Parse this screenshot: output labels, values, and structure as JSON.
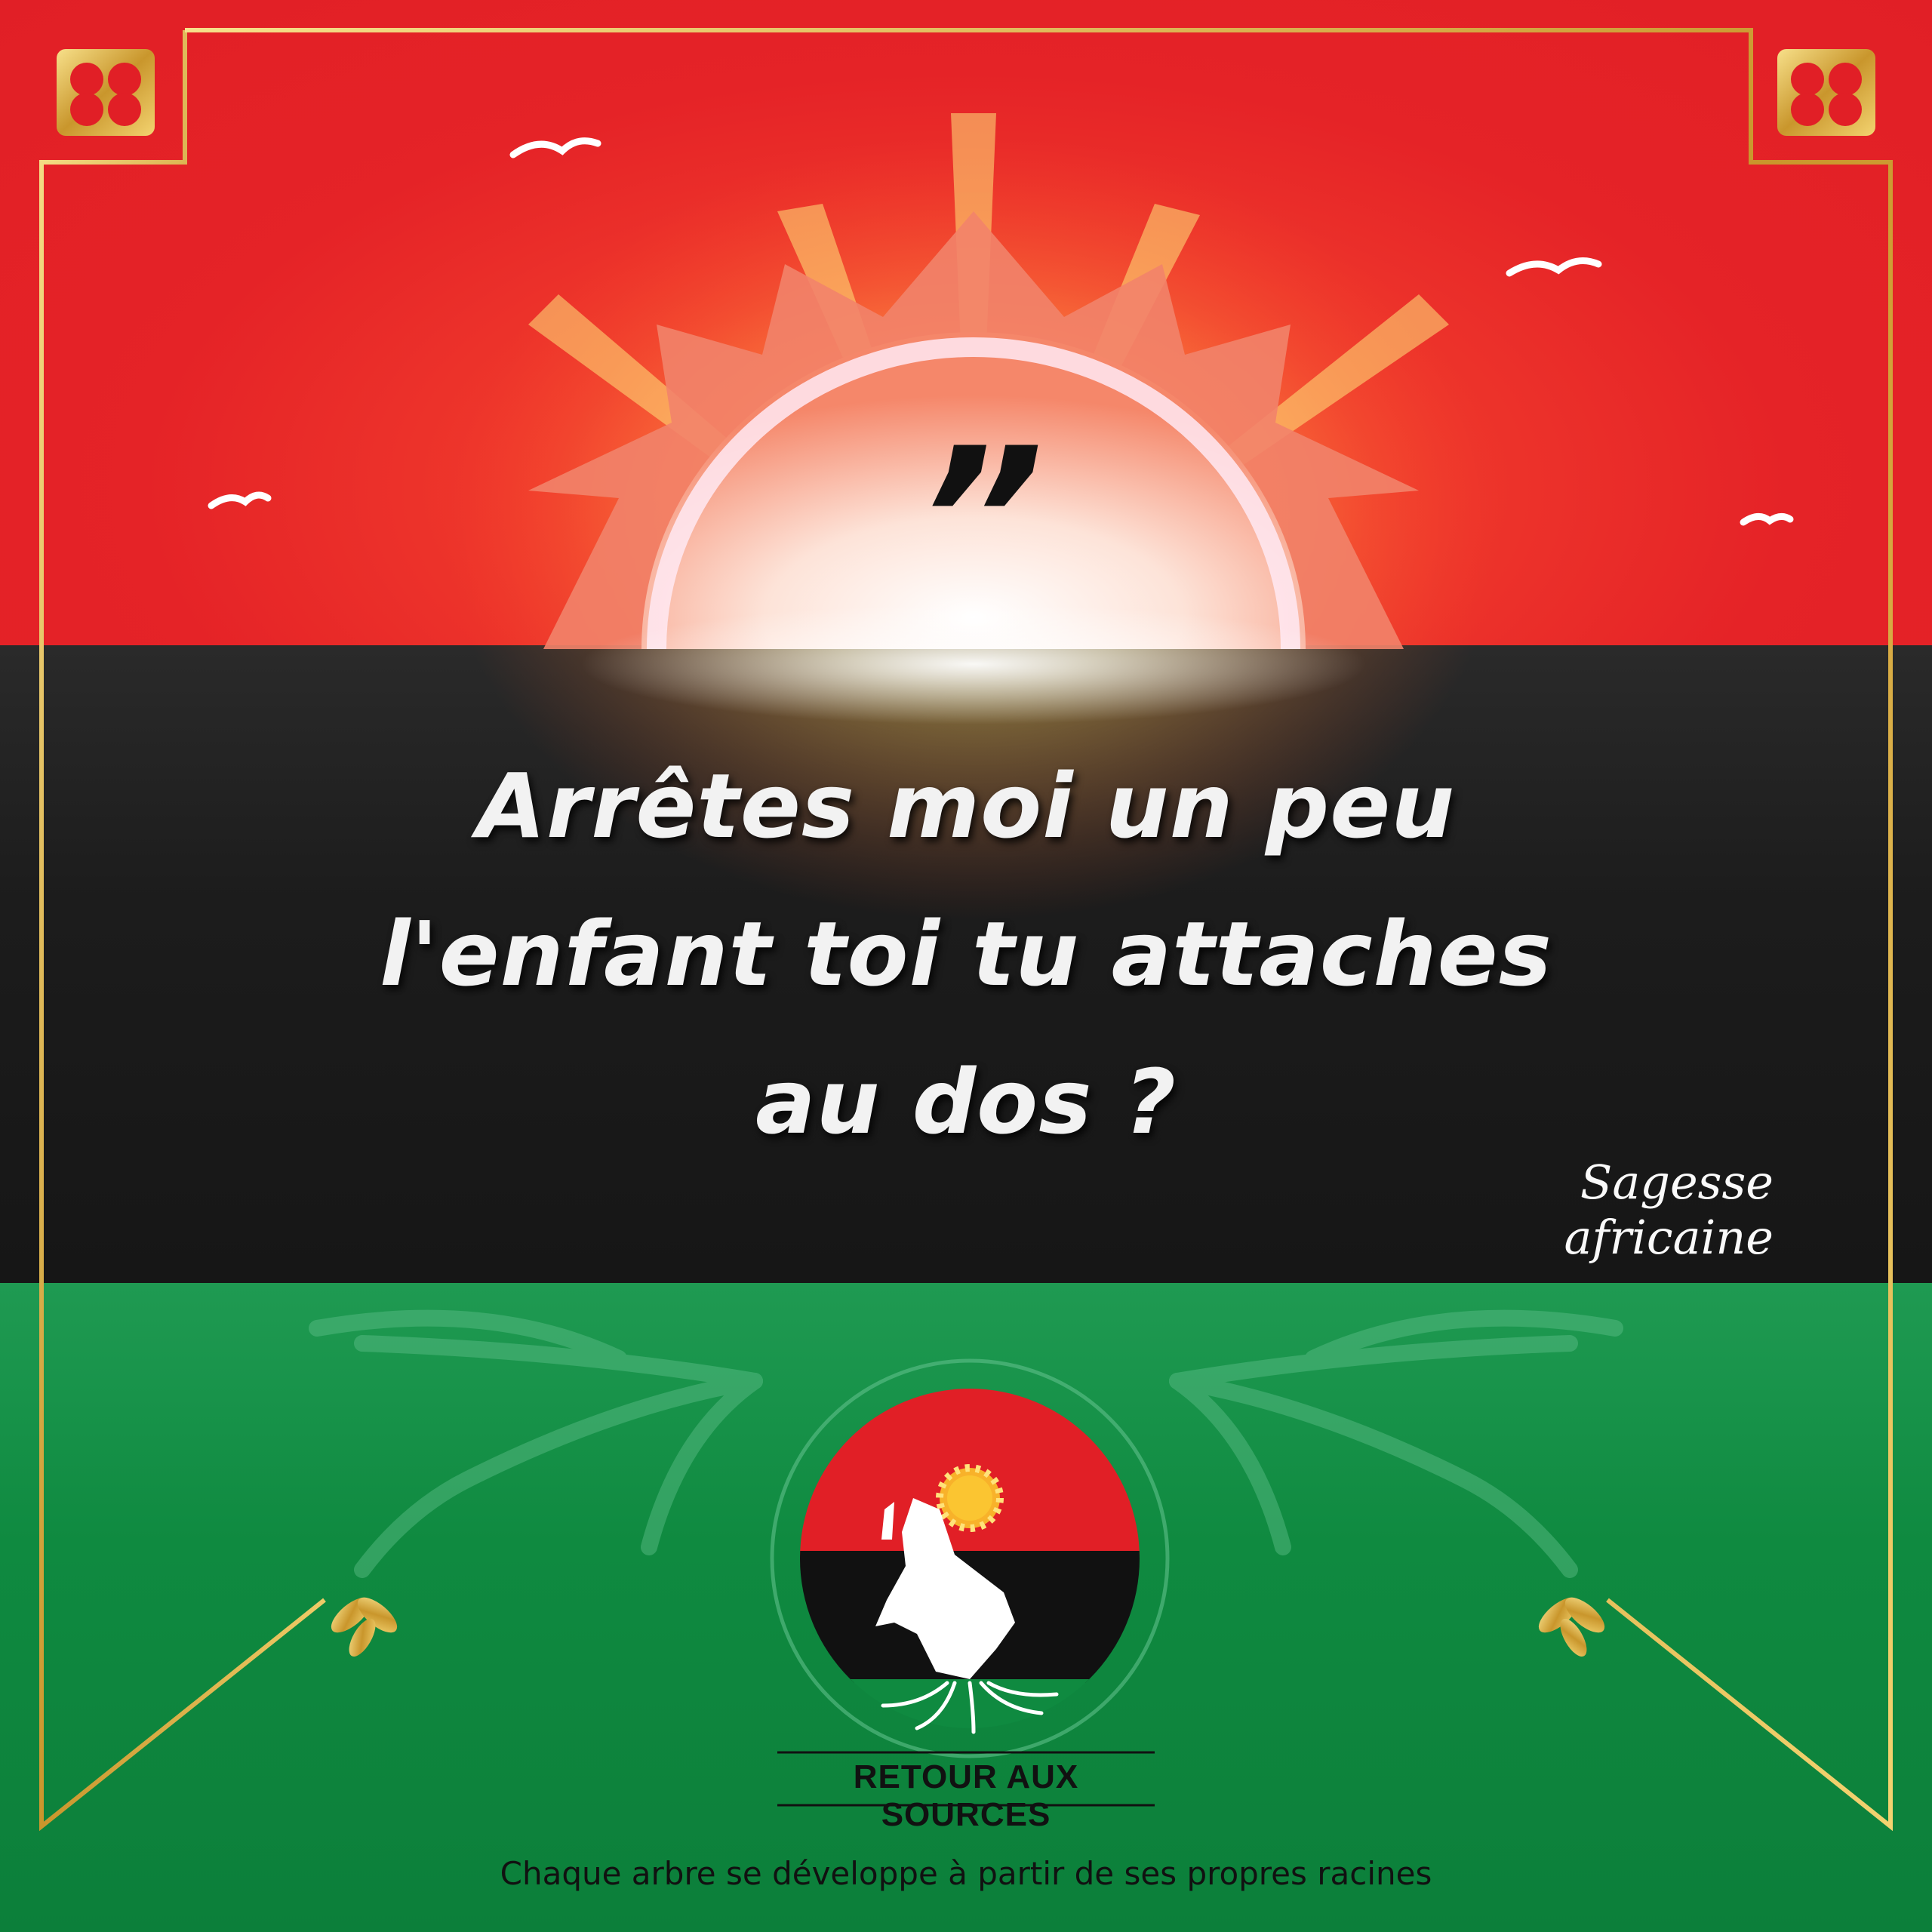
{
  "quote": {
    "mark": "”",
    "lines": [
      "Arrêtes moi un peu",
      "l'enfant toi tu attaches",
      "au dos ?"
    ],
    "attribution": "Sagesse africaine"
  },
  "brand": {
    "name": "RETOUR AUX SOURCES",
    "tagline": "Chaque arbre se développe à partir de ses propres racines"
  },
  "colors": {
    "red": "#e11f26",
    "black": "#1c1c1c",
    "green": "#0f8a40",
    "gold": "#d4a93a",
    "sun": "#f8b22a"
  },
  "icons": [
    "sun-icon",
    "bird-icon",
    "ornament-icon",
    "leaf-icon",
    "africa-map-icon",
    "roots-icon"
  ]
}
